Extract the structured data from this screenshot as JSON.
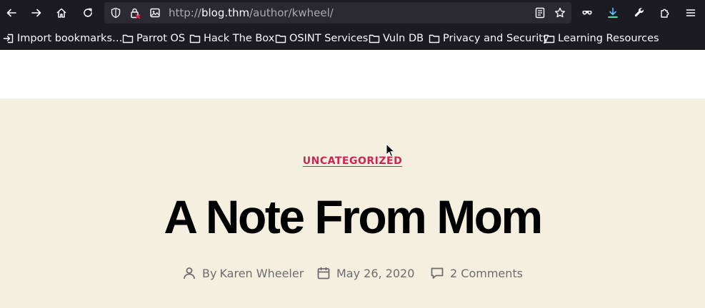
{
  "browser": {
    "url_scheme": "http://",
    "url_host": "blog.thm",
    "url_path": "/author/kwheel/",
    "toolbar_icons": [
      "back-arrow-icon",
      "forward-arrow-icon",
      "home-icon",
      "reload-icon",
      "shield-icon",
      "lock-warning-icon",
      "permissions-icon",
      "reader-mode-icon",
      "bookmark-star-icon",
      "extension-icon",
      "downloads-icon",
      "tools-wrench-icon",
      "extensions-icon",
      "menu-icon"
    ],
    "bookmarks": [
      {
        "label": "Import bookmarks…",
        "icon": "import-icon"
      },
      {
        "label": "Parrot OS",
        "icon": "folder-icon"
      },
      {
        "label": "Hack The Box",
        "icon": "folder-icon"
      },
      {
        "label": "OSINT Services",
        "icon": "folder-icon"
      },
      {
        "label": "Vuln DB",
        "icon": "folder-icon"
      },
      {
        "label": "Privacy and Security",
        "icon": "folder-icon"
      },
      {
        "label": "Learning Resources",
        "icon": "folder-icon"
      }
    ],
    "colors": {
      "chrome_bg": "#1c1b22",
      "urlbar_bg": "#2b2a33",
      "download_accent": "#54ffbd"
    }
  },
  "post": {
    "category": "UNCATEGORIZED",
    "title": "A Note From Mom",
    "author_prefix": "By",
    "author": "Karen Wheeler",
    "date": "May 26, 2020",
    "comments": "2 Comments"
  },
  "theme": {
    "hero_bg": "#f5efe0",
    "accent": "#cd2653",
    "meta_text": "#6d6d6d"
  }
}
